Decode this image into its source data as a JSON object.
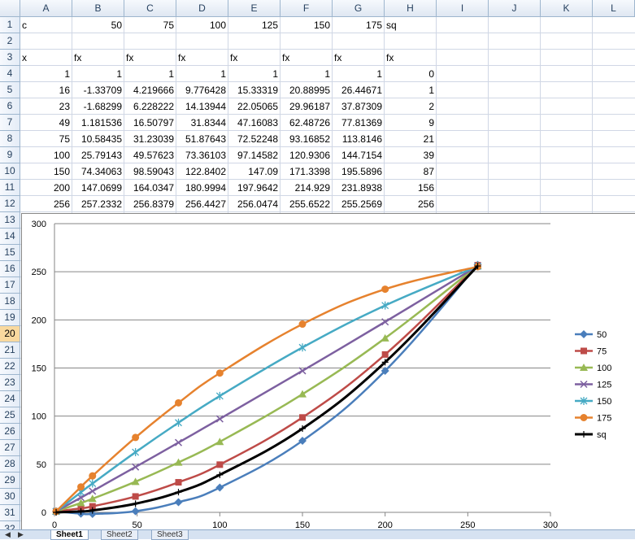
{
  "columns": [
    "A",
    "B",
    "C",
    "D",
    "E",
    "F",
    "G",
    "H",
    "I",
    "J",
    "K",
    "L"
  ],
  "rows": [
    "1",
    "2",
    "3",
    "4",
    "5",
    "6",
    "7",
    "8",
    "9",
    "10",
    "11",
    "12",
    "13",
    "14",
    "15",
    "16",
    "17",
    "18",
    "19",
    "20",
    "21",
    "22",
    "23",
    "24",
    "25",
    "26",
    "27",
    "28",
    "29",
    "30",
    "31",
    "32"
  ],
  "active_row": "20",
  "cells": {
    "r1": {
      "A": "c",
      "B": "50",
      "C": "75",
      "D": "100",
      "E": "125",
      "F": "150",
      "G": "175",
      "H": "sq"
    },
    "r3": {
      "A": "x",
      "B": "fx",
      "C": "fx",
      "D": "fx",
      "E": "fx",
      "F": "fx",
      "G": "fx",
      "H": "fx"
    },
    "r4": {
      "A": "1",
      "B": "1",
      "C": "1",
      "D": "1",
      "E": "1",
      "F": "1",
      "G": "1",
      "H": "0"
    },
    "r5": {
      "A": "16",
      "B": "-1.33709",
      "C": "4.219666",
      "D": "9.776428",
      "E": "15.33319",
      "F": "20.88995",
      "G": "26.44671",
      "H": "1"
    },
    "r6": {
      "A": "23",
      "B": "-1.68299",
      "C": "6.228222",
      "D": "14.13944",
      "E": "22.05065",
      "F": "29.96187",
      "G": "37.87309",
      "H": "2"
    },
    "r7": {
      "A": "49",
      "B": "1.181536",
      "C": "16.50797",
      "D": "31.8344",
      "E": "47.16083",
      "F": "62.48726",
      "G": "77.81369",
      "H": "9"
    },
    "r8": {
      "A": "75",
      "B": "10.58435",
      "C": "31.23039",
      "D": "51.87643",
      "E": "72.52248",
      "F": "93.16852",
      "G": "113.8146",
      "H": "21"
    },
    "r9": {
      "A": "100",
      "B": "25.79143",
      "C": "49.57623",
      "D": "73.36103",
      "E": "97.14582",
      "F": "120.9306",
      "G": "144.7154",
      "H": "39"
    },
    "r10": {
      "A": "150",
      "B": "74.34063",
      "C": "98.59043",
      "D": "122.8402",
      "E": "147.09",
      "F": "171.3398",
      "G": "195.5896",
      "H": "87"
    },
    "r11": {
      "A": "200",
      "B": "147.0699",
      "C": "164.0347",
      "D": "180.9994",
      "E": "197.9642",
      "F": "214.929",
      "G": "231.8938",
      "H": "156"
    },
    "r12": {
      "A": "256",
      "B": "257.2332",
      "C": "256.8379",
      "D": "256.4427",
      "E": "256.0474",
      "F": "255.6522",
      "G": "255.2569",
      "H": "256"
    }
  },
  "chart_data": {
    "type": "scatter",
    "title": "",
    "xlabel": "",
    "ylabel": "",
    "xlim": [
      0,
      300
    ],
    "ylim": [
      0,
      300
    ],
    "xticks": [
      "0",
      "50",
      "100",
      "150",
      "200",
      "250",
      "300"
    ],
    "yticks": [
      "0",
      "50",
      "100",
      "150",
      "200",
      "250",
      "300"
    ],
    "grid": "horizontal",
    "legend_position": "right",
    "x": [
      1,
      16,
      23,
      49,
      75,
      100,
      150,
      200,
      256
    ],
    "series": [
      {
        "name": "50",
        "color": "#4a7ebb",
        "marker": "diamond",
        "values": [
          1,
          -1.33709,
          -1.68299,
          1.181536,
          10.58435,
          25.79143,
          74.34063,
          147.0699,
          257.2332
        ]
      },
      {
        "name": "75",
        "color": "#be4b48",
        "marker": "square",
        "values": [
          1,
          4.219666,
          6.228222,
          16.50797,
          31.23039,
          49.57623,
          98.59043,
          164.0347,
          256.8379
        ]
      },
      {
        "name": "100",
        "color": "#98b954",
        "marker": "triangle",
        "values": [
          1,
          9.776428,
          14.13944,
          31.8344,
          51.87643,
          73.36103,
          122.8402,
          180.9994,
          256.4427
        ]
      },
      {
        "name": "125",
        "color": "#7d60a0",
        "marker": "x",
        "values": [
          1,
          15.33319,
          22.05065,
          47.16083,
          72.52248,
          97.14582,
          147.09,
          197.9642,
          256.0474
        ]
      },
      {
        "name": "150",
        "color": "#46aac4",
        "marker": "star",
        "values": [
          1,
          20.88995,
          29.96187,
          62.48726,
          93.16852,
          120.9306,
          171.3398,
          214.929,
          255.6522
        ]
      },
      {
        "name": "175",
        "color": "#e6822e",
        "marker": "circle",
        "values": [
          1,
          26.44671,
          37.87309,
          77.81369,
          113.8146,
          144.7154,
          195.5896,
          231.8938,
          255.2569
        ]
      },
      {
        "name": "sq",
        "color": "#000000",
        "marker": "plus",
        "values": [
          0,
          1,
          2,
          9,
          21,
          39,
          87,
          156,
          256
        ]
      }
    ]
  },
  "tabs": [
    "Sheet1",
    "Sheet2",
    "Sheet3"
  ],
  "active_tab": "Sheet1",
  "nav_buttons": [
    "◀",
    "▶"
  ]
}
